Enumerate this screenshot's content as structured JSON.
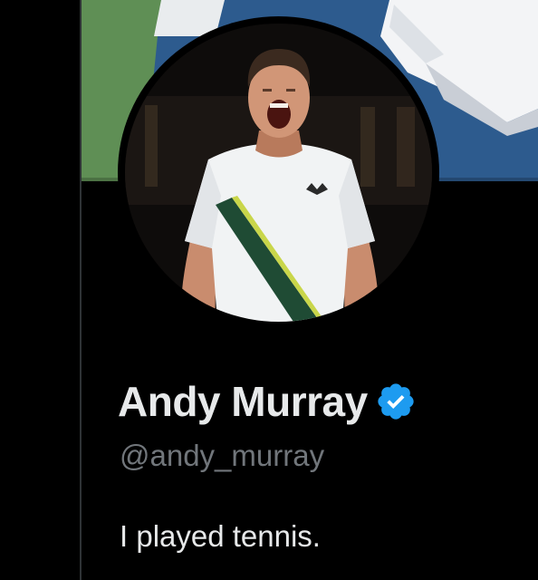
{
  "profile": {
    "display_name": "Andy Murray",
    "handle": "@andy_murray",
    "bio": "I played tennis.",
    "verified": true,
    "verified_icon": "verified-badge-icon",
    "banner_image": "tennis court surface with white lines and a towel",
    "avatar_image": "tennis player in white shirt shouting in celebration"
  },
  "colors": {
    "background": "#000000",
    "name_text": "#e7e9ea",
    "handle_text": "#71767b",
    "verified_blue": "#1d9bf0",
    "divider": "#2f3336"
  }
}
